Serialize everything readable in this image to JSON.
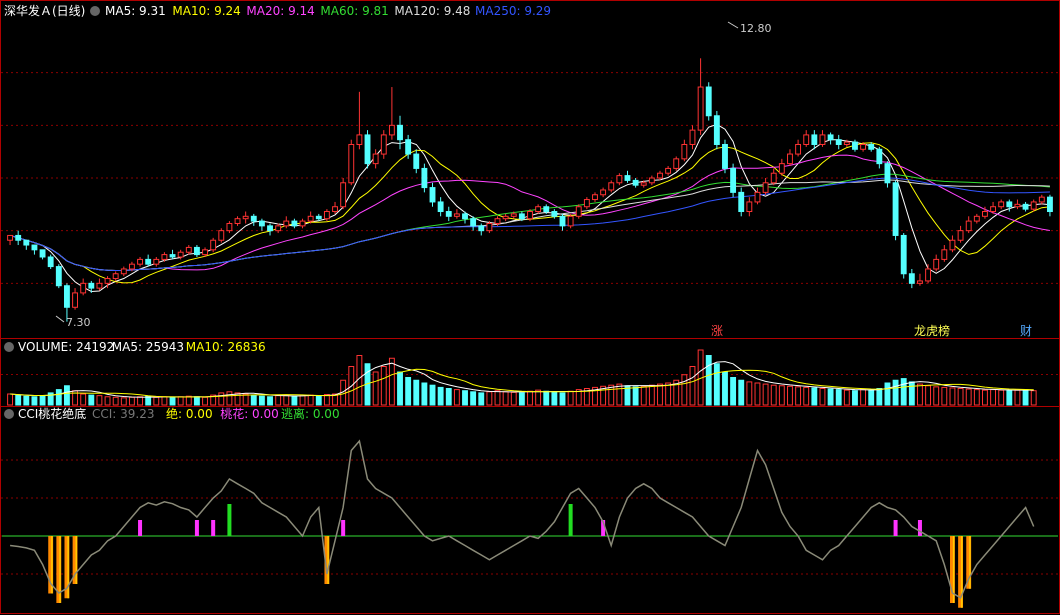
{
  "main_panel": {
    "stock_name": "深华发Ａ",
    "period": "(日线)",
    "indicators": [
      {
        "label": "MA5: 9.31",
        "color": "#ffffff"
      },
      {
        "label": "MA10: 9.24",
        "color": "#ffff00"
      },
      {
        "label": "MA20: 9.14",
        "color": "#ff44ff"
      },
      {
        "label": "MA60: 9.81",
        "color": "#33dd33"
      },
      {
        "label": "MA120: 9.48",
        "color": "#dddddd"
      },
      {
        "label": "MA250: 9.29",
        "color": "#3355ff"
      }
    ],
    "high_label": "12.80",
    "low_label": "7.30",
    "event_labels": [
      {
        "text": "涨",
        "color": "#ff4444"
      },
      {
        "text": "龙虎榜",
        "color": "#ffff55"
      },
      {
        "text": "财",
        "color": "#55aaff"
      }
    ]
  },
  "volume_panel": {
    "indicators": [
      {
        "label": "VOLUME: 24192",
        "color": "#ffffff"
      },
      {
        "label": "MA5: 25943",
        "color": "#ffffff"
      },
      {
        "label": "MA10: 26836",
        "color": "#ffff00"
      }
    ]
  },
  "cci_panel": {
    "title": "CCI桃花绝底",
    "indicators": [
      {
        "label": "CCI: 39.23",
        "color": "#777777"
      },
      {
        "label": "绝: 0.00",
        "color": "#ffff00"
      },
      {
        "label": "桃花: 0.00",
        "color": "#ff44ff"
      },
      {
        "label": "逃离: 0.00",
        "color": "#33dd33"
      }
    ]
  },
  "colors": {
    "up": "#ff3333",
    "down": "#55ffff",
    "grid": "#8b0000",
    "border": "#b00000"
  },
  "chart_data": [
    {
      "type": "candlestick",
      "ylim": [
        7.0,
        13.6
      ],
      "note_points": {
        "high": 12.8,
        "low": 7.3
      },
      "candles": [
        [
          9.0,
          9.1,
          9.1,
          8.9
        ],
        [
          9.1,
          9.0,
          9.2,
          8.9
        ],
        [
          9.0,
          8.9,
          9.0,
          8.8
        ],
        [
          8.9,
          8.8,
          8.9,
          8.7
        ],
        [
          8.8,
          8.65,
          8.8,
          8.6
        ],
        [
          8.65,
          8.45,
          8.7,
          8.4
        ],
        [
          8.45,
          8.05,
          8.5,
          8.0
        ],
        [
          8.05,
          7.6,
          8.1,
          7.3
        ],
        [
          7.6,
          7.9,
          8.0,
          7.55
        ],
        [
          7.9,
          8.1,
          8.2,
          7.85
        ],
        [
          8.1,
          8.0,
          8.15,
          7.9
        ],
        [
          8.0,
          8.1,
          8.2,
          7.95
        ],
        [
          8.1,
          8.2,
          8.25,
          8.0
        ],
        [
          8.2,
          8.3,
          8.35,
          8.15
        ],
        [
          8.3,
          8.4,
          8.45,
          8.25
        ],
        [
          8.4,
          8.5,
          8.55,
          8.35
        ],
        [
          8.5,
          8.6,
          8.65,
          8.45
        ],
        [
          8.6,
          8.5,
          8.7,
          8.45
        ],
        [
          8.5,
          8.6,
          8.65,
          8.45
        ],
        [
          8.6,
          8.7,
          8.75,
          8.55
        ],
        [
          8.7,
          8.65,
          8.8,
          8.6
        ],
        [
          8.65,
          8.75,
          8.8,
          8.6
        ],
        [
          8.75,
          8.85,
          8.9,
          8.7
        ],
        [
          8.85,
          8.7,
          8.9,
          8.65
        ],
        [
          8.7,
          8.8,
          8.85,
          8.65
        ],
        [
          8.8,
          9.0,
          9.05,
          8.75
        ],
        [
          9.0,
          9.2,
          9.25,
          8.95
        ],
        [
          9.2,
          9.35,
          9.4,
          9.15
        ],
        [
          9.35,
          9.45,
          9.5,
          9.3
        ],
        [
          9.45,
          9.5,
          9.6,
          9.35
        ],
        [
          9.5,
          9.4,
          9.55,
          9.3
        ],
        [
          9.4,
          9.3,
          9.45,
          9.2
        ],
        [
          9.3,
          9.2,
          9.35,
          9.1
        ],
        [
          9.2,
          9.3,
          9.35,
          9.15
        ],
        [
          9.3,
          9.4,
          9.5,
          9.25
        ],
        [
          9.4,
          9.3,
          9.45,
          9.25
        ],
        [
          9.3,
          9.4,
          9.45,
          9.25
        ],
        [
          9.4,
          9.5,
          9.6,
          9.35
        ],
        [
          9.5,
          9.45,
          9.55,
          9.4
        ],
        [
          9.45,
          9.6,
          9.65,
          9.4
        ],
        [
          9.6,
          9.7,
          9.8,
          9.55
        ],
        [
          9.7,
          10.2,
          10.3,
          9.65
        ],
        [
          10.2,
          11.0,
          11.1,
          10.15
        ],
        [
          11.0,
          11.2,
          12.1,
          10.9
        ],
        [
          11.2,
          10.6,
          11.3,
          10.5
        ],
        [
          10.6,
          10.8,
          10.9,
          10.5
        ],
        [
          10.8,
          11.2,
          11.3,
          10.7
        ],
        [
          11.2,
          11.4,
          12.2,
          11.1
        ],
        [
          11.4,
          11.1,
          11.6,
          10.9
        ],
        [
          11.1,
          10.8,
          11.2,
          10.7
        ],
        [
          10.8,
          10.5,
          10.9,
          10.4
        ],
        [
          10.5,
          10.1,
          10.6,
          10.0
        ],
        [
          10.1,
          9.8,
          10.2,
          9.7
        ],
        [
          9.8,
          9.6,
          9.9,
          9.5
        ],
        [
          9.6,
          9.5,
          9.7,
          9.4
        ],
        [
          9.5,
          9.55,
          9.65,
          9.45
        ],
        [
          9.55,
          9.45,
          9.6,
          9.35
        ],
        [
          9.45,
          9.3,
          9.5,
          9.2
        ],
        [
          9.3,
          9.2,
          9.35,
          9.1
        ],
        [
          9.2,
          9.35,
          9.4,
          9.15
        ],
        [
          9.35,
          9.45,
          9.5,
          9.3
        ],
        [
          9.45,
          9.5,
          9.55,
          9.4
        ],
        [
          9.5,
          9.55,
          9.6,
          9.45
        ],
        [
          9.55,
          9.45,
          9.6,
          9.4
        ],
        [
          9.45,
          9.6,
          9.65,
          9.4
        ],
        [
          9.6,
          9.7,
          9.75,
          9.55
        ],
        [
          9.7,
          9.6,
          9.75,
          9.55
        ],
        [
          9.6,
          9.5,
          9.65,
          9.45
        ],
        [
          9.5,
          9.3,
          9.55,
          9.2
        ],
        [
          9.3,
          9.5,
          9.55,
          9.25
        ],
        [
          9.5,
          9.7,
          9.75,
          9.45
        ],
        [
          9.7,
          9.85,
          9.9,
          9.65
        ],
        [
          9.85,
          9.95,
          10.0,
          9.8
        ],
        [
          9.95,
          10.05,
          10.1,
          9.9
        ],
        [
          10.05,
          10.2,
          10.25,
          10.0
        ],
        [
          10.2,
          10.35,
          10.4,
          10.15
        ],
        [
          10.35,
          10.25,
          10.45,
          10.2
        ],
        [
          10.25,
          10.15,
          10.3,
          10.1
        ],
        [
          10.15,
          10.2,
          10.25,
          10.1
        ],
        [
          10.2,
          10.3,
          10.35,
          10.15
        ],
        [
          10.3,
          10.4,
          10.45,
          10.25
        ],
        [
          10.4,
          10.5,
          10.55,
          10.35
        ],
        [
          10.5,
          10.7,
          10.75,
          10.45
        ],
        [
          10.7,
          11.0,
          11.1,
          10.65
        ],
        [
          11.0,
          11.3,
          11.4,
          10.9
        ],
        [
          11.3,
          12.2,
          12.8,
          11.2
        ],
        [
          12.2,
          11.6,
          12.3,
          11.5
        ],
        [
          11.6,
          11.0,
          11.7,
          10.9
        ],
        [
          11.0,
          10.5,
          11.1,
          10.4
        ],
        [
          10.5,
          10.0,
          10.6,
          9.9
        ],
        [
          10.0,
          9.6,
          10.1,
          9.5
        ],
        [
          9.6,
          9.8,
          9.9,
          9.5
        ],
        [
          9.8,
          10.0,
          10.1,
          9.75
        ],
        [
          10.0,
          10.2,
          10.3,
          9.95
        ],
        [
          10.2,
          10.4,
          10.5,
          10.15
        ],
        [
          10.4,
          10.6,
          10.7,
          10.35
        ],
        [
          10.6,
          10.8,
          10.9,
          10.55
        ],
        [
          10.8,
          11.0,
          11.1,
          10.75
        ],
        [
          11.0,
          11.2,
          11.3,
          10.95
        ],
        [
          11.2,
          11.0,
          11.3,
          10.9
        ],
        [
          11.0,
          11.2,
          11.3,
          10.95
        ],
        [
          11.2,
          11.1,
          11.25,
          11.0
        ],
        [
          11.1,
          11.0,
          11.2,
          10.9
        ],
        [
          11.0,
          11.05,
          11.1,
          10.95
        ],
        [
          11.05,
          10.9,
          11.1,
          10.85
        ],
        [
          10.9,
          11.0,
          11.05,
          10.85
        ],
        [
          11.0,
          10.9,
          11.05,
          10.85
        ],
        [
          10.9,
          10.6,
          10.95,
          10.5
        ],
        [
          10.6,
          10.2,
          10.65,
          10.1
        ],
        [
          10.2,
          9.1,
          10.25,
          9.0
        ],
        [
          9.1,
          8.3,
          9.15,
          8.2
        ],
        [
          8.3,
          8.1,
          8.4,
          8.0
        ],
        [
          8.1,
          8.15,
          8.3,
          8.05
        ],
        [
          8.15,
          8.4,
          8.5,
          8.1
        ],
        [
          8.4,
          8.6,
          8.7,
          8.35
        ],
        [
          8.6,
          8.8,
          8.9,
          8.55
        ],
        [
          8.8,
          9.0,
          9.1,
          8.75
        ],
        [
          9.0,
          9.2,
          9.3,
          8.95
        ],
        [
          9.2,
          9.4,
          9.5,
          9.15
        ],
        [
          9.4,
          9.5,
          9.55,
          9.35
        ],
        [
          9.5,
          9.6,
          9.7,
          9.45
        ],
        [
          9.6,
          9.7,
          9.8,
          9.55
        ],
        [
          9.7,
          9.8,
          9.85,
          9.65
        ],
        [
          9.8,
          9.7,
          9.85,
          9.6
        ],
        [
          9.7,
          9.75,
          9.85,
          9.65
        ],
        [
          9.75,
          9.65,
          9.8,
          9.6
        ],
        [
          9.65,
          9.8,
          9.85,
          9.6
        ],
        [
          9.8,
          9.9,
          9.95,
          9.75
        ],
        [
          9.9,
          9.6,
          9.95,
          9.5
        ]
      ],
      "ma_lines": [
        {
          "name": "MA5",
          "color": "#ffffff",
          "window": 5
        },
        {
          "name": "MA10",
          "color": "#ffff00",
          "window": 10
        },
        {
          "name": "MA20",
          "color": "#ff44ff",
          "window": 20
        },
        {
          "name": "MA60",
          "color": "#33dd33",
          "window": 60
        },
        {
          "name": "MA120",
          "color": "#dddddd",
          "window": 120
        },
        {
          "name": "MA250",
          "color": "#3355ff",
          "window": 250
        }
      ]
    },
    {
      "type": "bar",
      "volumes": [
        20,
        18,
        16,
        15,
        17,
        22,
        28,
        35,
        26,
        20,
        18,
        17,
        15,
        14,
        13,
        14,
        15,
        16,
        14,
        15,
        14,
        15,
        16,
        15,
        14,
        18,
        22,
        24,
        22,
        20,
        18,
        16,
        15,
        17,
        18,
        16,
        17,
        18,
        17,
        19,
        20,
        45,
        70,
        90,
        75,
        60,
        70,
        85,
        60,
        50,
        45,
        40,
        36,
        32,
        30,
        28,
        26,
        24,
        22,
        24,
        26,
        24,
        23,
        22,
        25,
        27,
        25,
        24,
        22,
        25,
        28,
        30,
        32,
        34,
        36,
        38,
        35,
        33,
        34,
        36,
        38,
        40,
        45,
        55,
        70,
        100,
        90,
        75,
        60,
        50,
        45,
        42,
        40,
        38,
        36,
        35,
        34,
        33,
        32,
        31,
        30,
        29,
        28,
        27,
        26,
        28,
        27,
        30,
        40,
        45,
        48,
        42,
        38,
        35,
        33,
        32,
        31,
        30,
        29,
        28,
        27,
        28,
        27,
        26,
        27,
        28,
        26
      ]
    },
    {
      "type": "line",
      "cci": [
        -20,
        -22,
        -25,
        -30,
        -60,
        -100,
        -120,
        -110,
        -80,
        -60,
        -40,
        -30,
        -10,
        0,
        20,
        40,
        60,
        70,
        65,
        72,
        68,
        60,
        55,
        40,
        60,
        80,
        95,
        120,
        110,
        100,
        90,
        70,
        60,
        50,
        40,
        20,
        0,
        40,
        60,
        -80,
        -10,
        60,
        180,
        200,
        120,
        100,
        90,
        80,
        60,
        40,
        20,
        0,
        -10,
        -5,
        0,
        -10,
        -20,
        -30,
        -40,
        -50,
        -40,
        -30,
        -20,
        -10,
        0,
        -5,
        10,
        30,
        60,
        90,
        100,
        80,
        60,
        30,
        -20,
        40,
        80,
        100,
        110,
        100,
        80,
        70,
        60,
        50,
        40,
        20,
        0,
        -10,
        -20,
        20,
        60,
        120,
        180,
        150,
        100,
        50,
        20,
        0,
        -30,
        -40,
        -50,
        -30,
        -20,
        0,
        20,
        40,
        60,
        70,
        60,
        55,
        40,
        20,
        10,
        0,
        -10,
        -60,
        -120,
        -130,
        -90,
        -60,
        -40,
        -20,
        0,
        20,
        40,
        60,
        20
      ],
      "ylim": [
        -160,
        240
      ],
      "zero": 0
    }
  ]
}
